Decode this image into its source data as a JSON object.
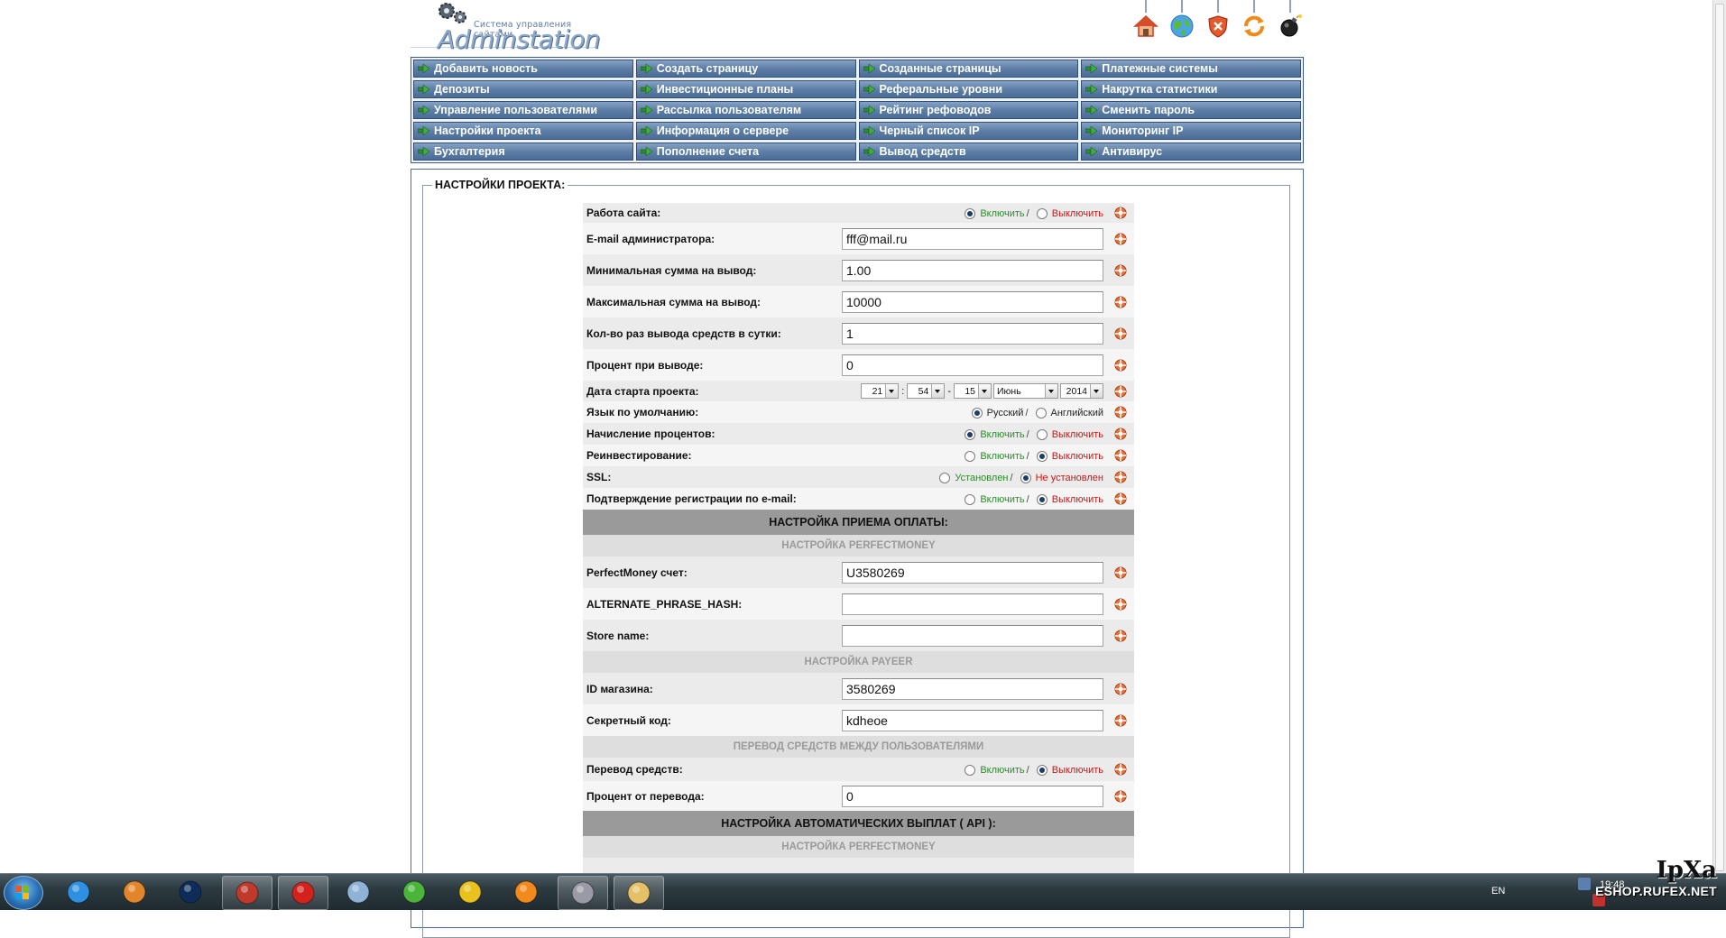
{
  "header": {
    "tagline": "Система управления сайтами",
    "brand": "Adminstation",
    "icons": [
      "home-icon",
      "globe-icon",
      "shield-icon",
      "refresh-icon",
      "bomb-icon"
    ]
  },
  "menu": [
    "Добавить новость",
    "Создать страницу",
    "Созданные страницы",
    "Платежные системы",
    "Депозиты",
    "Инвестиционные планы",
    "Реферальные уровни",
    "Накрутка статистики",
    "Управление пользователями",
    "Рассылка пользователям",
    "Рейтинг рефоводов",
    "Сменить пароль",
    "Настройки проекта",
    "Информация о сервере",
    "Черный список IP",
    "Мониторинг IP",
    "Бухгалтерия",
    "Пополнение счета",
    "Вывод средств",
    "Антивирус"
  ],
  "panel": {
    "legend": "НАСТРОЙКИ ПРОЕКТА:"
  },
  "options": {
    "on": "Включить",
    "off": "Выключить",
    "russian": "Русский",
    "english": "Английский",
    "installed": "Установлен",
    "not_installed": "Не установлен",
    "slash": "/"
  },
  "fields": {
    "site_work": "Работа сайта:",
    "admin_email": {
      "label": "E-mail администратора:",
      "value": "fff@mail.ru"
    },
    "min_withdraw": {
      "label": "Минимальная сумма на вывод:",
      "value": "1.00"
    },
    "max_withdraw": {
      "label": "Максимальная сумма на вывод:",
      "value": "10000"
    },
    "withdraw_per_day": {
      "label": "Кол-во раз вывода средств в сутки:",
      "value": "1"
    },
    "withdraw_percent": {
      "label": "Процент при выводе:",
      "value": "0"
    },
    "start_date": {
      "label": "Дата старта проекта:",
      "hour": "21",
      "minute": "54",
      "day": "15",
      "month": "Июнь",
      "year": "2014",
      "sep_colon": ":",
      "sep_dash": "-"
    },
    "default_lang": "Язык по умолчанию:",
    "interest": "Начисление процентов:",
    "reinvest": "Реинвестирование:",
    "ssl": "SSL:",
    "email_confirm": "Подтверждение регистрации по e-mail:"
  },
  "payment": {
    "section_title": "НАСТРОЙКА ПРИЕМА ОПЛАТЫ:",
    "pm_title": "НАСТРОЙКА PERFECTMONEY",
    "pm_account": {
      "label": "PerfectMoney счет:",
      "value": "U3580269"
    },
    "pm_hash": {
      "label": "ALTERNATE_PHRASE_HASH:",
      "value": ""
    },
    "pm_store": {
      "label": "Store name:",
      "value": ""
    },
    "payeer_title": "НАСТРОЙКА PAYEER",
    "payeer_id": {
      "label": "ID магазина:",
      "value": "3580269"
    },
    "payeer_secret": {
      "label": "Секретный код:",
      "value": "kdheoe"
    },
    "transfer_title": "ПЕРЕВОД СРЕДСТВ МЕЖДУ ПОЛЬЗОВАТЕЛЯМИ",
    "transfer": "Перевод средств:",
    "transfer_percent": {
      "label": "Процент от перевода:",
      "value": "0"
    },
    "auto_title": "НАСТРОЙКА АВТОМАТИЧЕСКИХ ВЫПЛАТ ( API ):",
    "auto_pm_title": "НАСТРОЙКА PERFECTMONEY"
  },
  "taskbar": {
    "apps": [
      "ie-icon",
      "media-player-icon",
      "photoshop-icon",
      "filezilla-icon",
      "opera-icon",
      "paint-icon",
      "icq-icon",
      "chrome-icon",
      "winamp-icon",
      "notepad-icon",
      "explorer-icon"
    ],
    "lang": "EN",
    "clock": "19:48"
  },
  "watermark": {
    "main": "IpXa",
    "site": "ESHOP.RUFEX.NET"
  }
}
